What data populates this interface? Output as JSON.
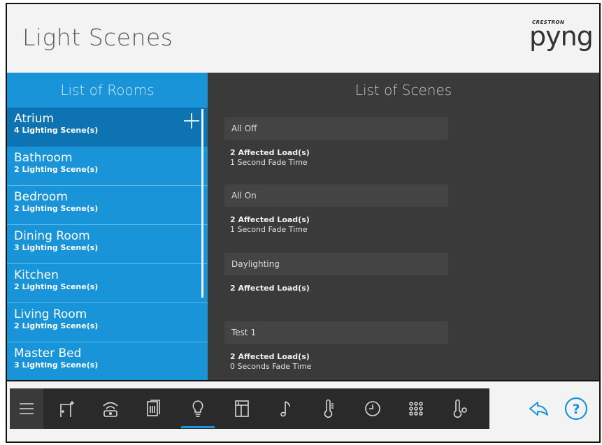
{
  "header": {
    "title": "Light Scenes",
    "brand_small": "CRESTRON",
    "brand_big": "pyng"
  },
  "rooms": {
    "header": "List of Rooms",
    "items": [
      {
        "name": "Atrium",
        "count": "4 Lighting Scene(s)",
        "selected": true
      },
      {
        "name": "Bathroom",
        "count": "2 Lighting Scene(s)"
      },
      {
        "name": "Bedroom",
        "count": "2 Lighting Scene(s)"
      },
      {
        "name": "Dining Room",
        "count": "3 Lighting Scene(s)"
      },
      {
        "name": "Kitchen",
        "count": "2 Lighting Scene(s)"
      },
      {
        "name": "Living Room",
        "count": "2 Lighting Scene(s)"
      },
      {
        "name": "Master Bed",
        "count": "3 Lighting Scene(s)"
      }
    ]
  },
  "scenes": {
    "header": "List of Scenes",
    "items": [
      {
        "name": "All Off",
        "loads": "2 Affected Load(s)",
        "fade": "1 Second Fade Time"
      },
      {
        "name": "All On",
        "loads": "2 Affected Load(s)",
        "fade": "1 Second Fade Time"
      },
      {
        "name": "Daylighting",
        "loads": "2 Affected Load(s)",
        "fade": ""
      },
      {
        "name": "Test 1",
        "loads": "2 Affected Load(s)",
        "fade": "0 Seconds Fade Time"
      }
    ]
  },
  "nav": {
    "icons": [
      "menu-icon",
      "room-door-icon",
      "wifi-remote-icon",
      "shades-icon",
      "lightbulb-icon",
      "window-icon",
      "music-note-icon",
      "thermometer-icon",
      "clock-icon",
      "keypad-icon",
      "temperature-sensor-icon"
    ],
    "active": "lightbulb-icon",
    "accent": "#1a94d8"
  },
  "colors": {
    "rooms_panel": "#1a94d8",
    "rooms_selected": "#0d73b3",
    "scenes_panel": "#3a3a3a",
    "nav_bar": "#2a2a2a"
  }
}
